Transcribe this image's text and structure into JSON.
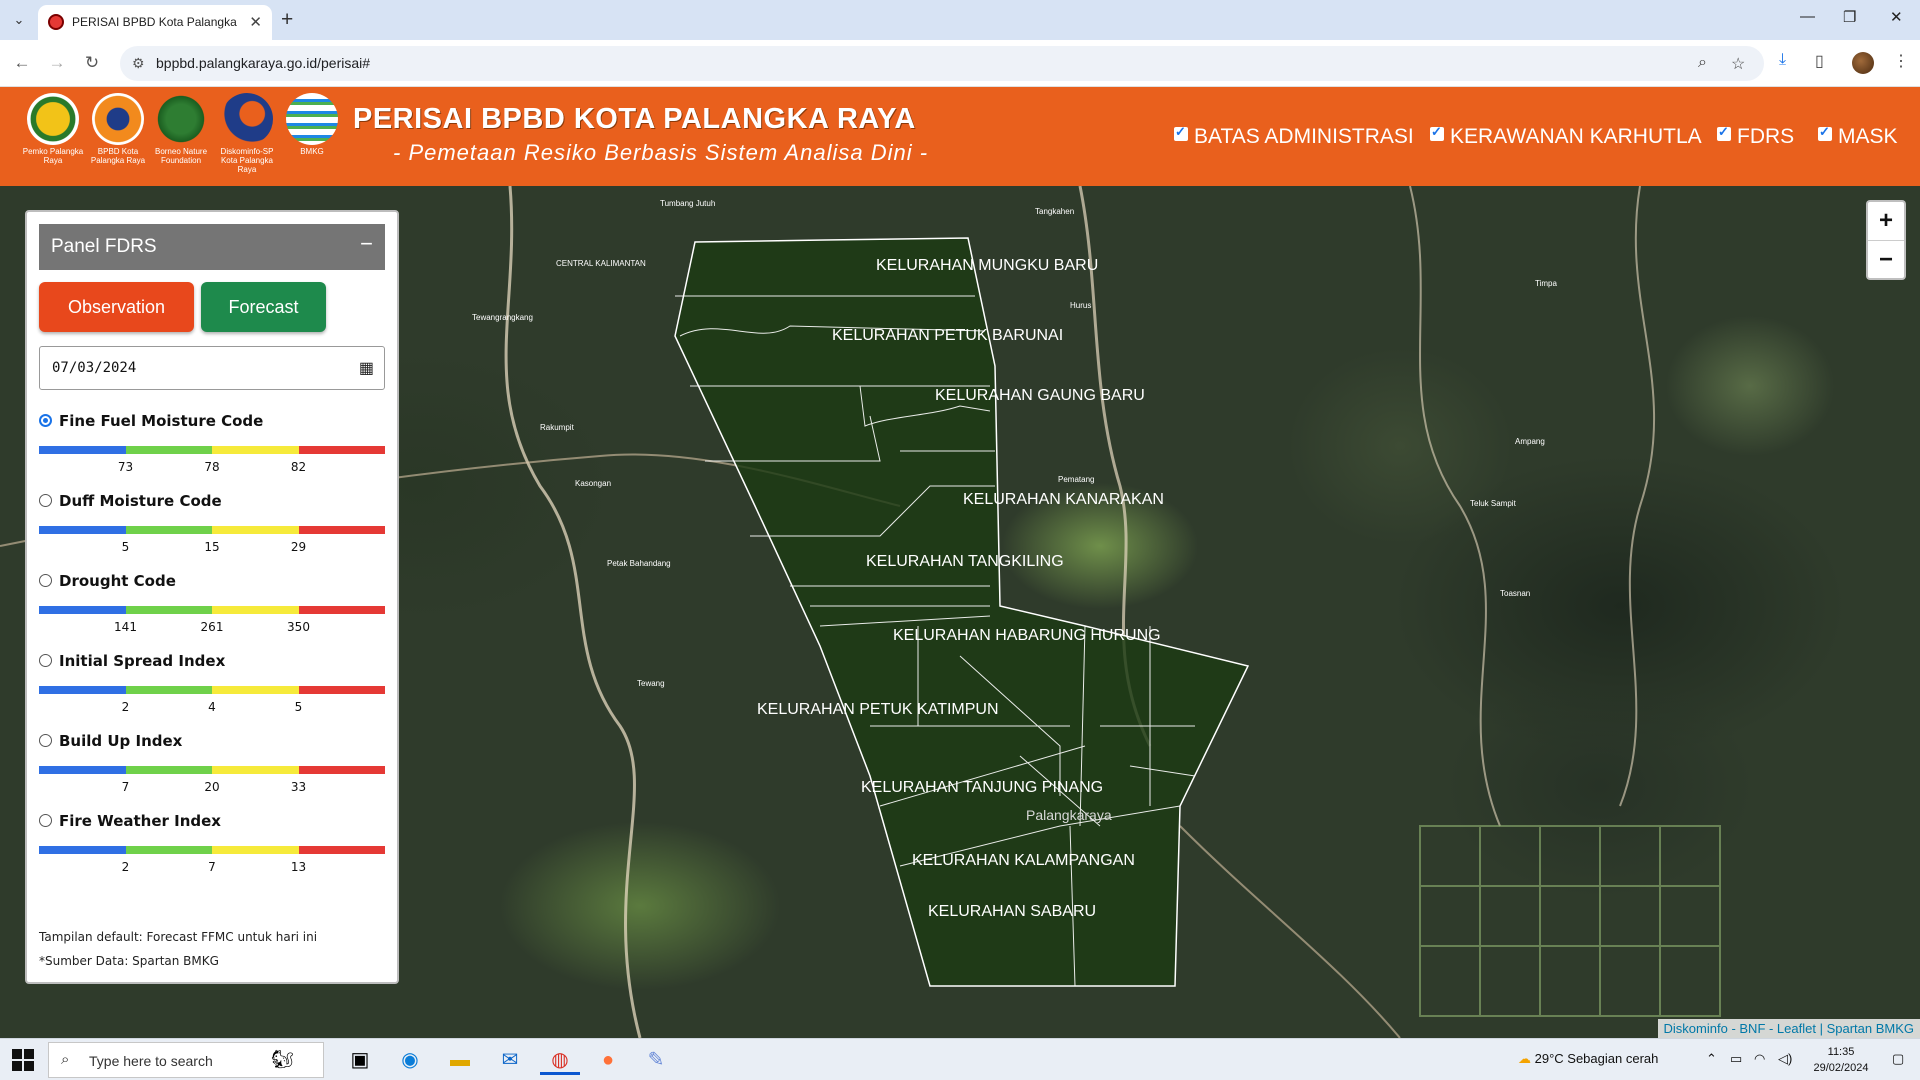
{
  "browser": {
    "tab_title": "PERISAI BPBD Kota Palangka Ra",
    "url": "bppbd.palangkaraya.go.id/perisai#"
  },
  "header": {
    "title": "PERISAI BPBD KOTA PALANGKA RAYA",
    "subtitle": "- Pemetaan Resiko Berbasis Sistem Analisa Dini -",
    "logos": [
      {
        "caption": "Pemko Palangka Raya",
        "color": "#f2c318"
      },
      {
        "caption": "BPBD Kota Palangka Raya",
        "color": "#f28a1d"
      },
      {
        "caption": "Borneo Nature Foundation",
        "color": "#2e7d32"
      },
      {
        "caption": "Diskominfo-SP Kota Palangka Raya",
        "color": "#1f3c88"
      },
      {
        "caption": "BMKG",
        "color": "#1e88e5"
      }
    ],
    "layers": [
      {
        "label": "BATAS ADMINISTRASI",
        "checked": true
      },
      {
        "label": "KERAWANAN KARHUTLA",
        "checked": true
      },
      {
        "label": "FDRS",
        "checked": true
      },
      {
        "label": "MASK",
        "checked": true
      }
    ]
  },
  "panel": {
    "title": "Panel FDRS",
    "collapse": "−",
    "observation_label": "Observation",
    "forecast_label": "Forecast",
    "date_value": "07/03/2024",
    "scale_colors": [
      "#2f6fe4",
      "#6fd14a",
      "#f6ea3a",
      "#e53935"
    ],
    "indices": [
      {
        "label": "Fine Fuel Moisture Code",
        "selected": true,
        "ticks": [
          "73",
          "78",
          "82"
        ]
      },
      {
        "label": "Duff Moisture Code",
        "selected": false,
        "ticks": [
          "5",
          "15",
          "29"
        ]
      },
      {
        "label": "Drought Code",
        "selected": false,
        "ticks": [
          "141",
          "261",
          "350"
        ]
      },
      {
        "label": "Initial Spread Index",
        "selected": false,
        "ticks": [
          "2",
          "4",
          "5"
        ]
      },
      {
        "label": "Build Up Index",
        "selected": false,
        "ticks": [
          "7",
          "20",
          "33"
        ]
      },
      {
        "label": "Fire Weather Index",
        "selected": false,
        "ticks": [
          "2",
          "7",
          "13"
        ]
      }
    ],
    "note_default": "Tampilan default: Forecast FFMC untuk hari ini",
    "note_source": "*Sumber Data: Spartan BMKG"
  },
  "map": {
    "zoom_in": "+",
    "zoom_out": "−",
    "city_label": "Palangkaraya",
    "kelurahan": [
      "KELURAHAN MUNGKU BARU",
      "KELURAHAN PETUK BARUNAI",
      "KELURAHAN GAUNG BARU",
      "KELURAHAN KANARAKAN",
      "KELURAHAN TANGKILING",
      "KELURAHAN HABARUNG HURUNG",
      "KELURAHAN PETUK KATIMPUN",
      "KELURAHAN TANJUNG PINANG",
      "KELURAHAN KALAMPANGAN",
      "KELURAHAN SABARU"
    ],
    "place_labels": [
      "Tumbang Jutuh",
      "CENTRAL KALIMANTAN",
      "Tewangrangkang",
      "Tangkahen",
      "Hurus",
      "Timpa",
      "Ampang",
      "Teluk Sampit",
      "Petak Bahandang",
      "Rakumpit",
      "Pematang",
      "Kasongan",
      "Tewang",
      "Toasnan"
    ],
    "attribution": "Diskominfo - BNF - Leaflet | Spartan BMKG"
  },
  "taskbar": {
    "search_placeholder": "Type here to search",
    "weather": "29°C  Sebagian cerah",
    "time": "11:35",
    "date": "29/02/2024"
  }
}
